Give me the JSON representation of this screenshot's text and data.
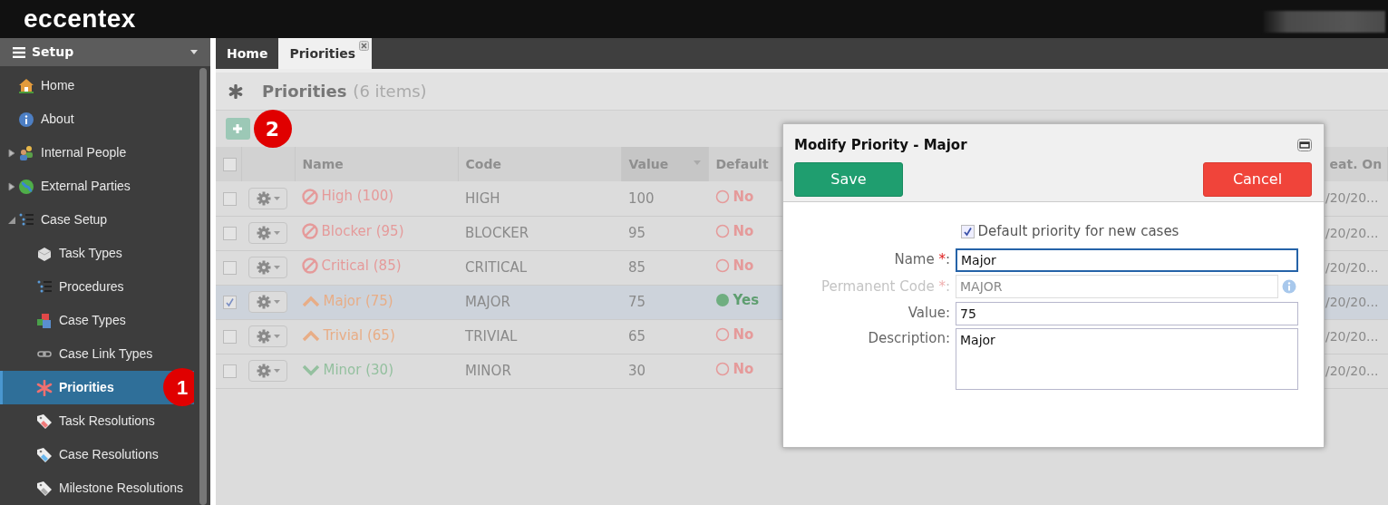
{
  "app": {
    "logo": "eccentex"
  },
  "sidebar": {
    "title": "Setup",
    "items": [
      {
        "label": "Home",
        "selected": false
      },
      {
        "label": "About",
        "selected": false
      },
      {
        "label": "Internal People",
        "selected": false,
        "expanded": false
      },
      {
        "label": "External Parties",
        "selected": false,
        "expanded": false
      },
      {
        "label": "Case Setup",
        "selected": false,
        "expanded": true,
        "children": [
          {
            "label": "Task Types",
            "selected": false
          },
          {
            "label": "Procedures",
            "selected": false
          },
          {
            "label": "Case Types",
            "selected": false
          },
          {
            "label": "Case Link Types",
            "selected": false
          },
          {
            "label": "Priorities",
            "selected": true,
            "callout": "1"
          },
          {
            "label": "Task Resolutions",
            "selected": false
          },
          {
            "label": "Case Resolutions",
            "selected": false
          },
          {
            "label": "Milestone Resolutions",
            "selected": false
          }
        ]
      }
    ]
  },
  "tabs": [
    {
      "label": "Home",
      "selected": false,
      "closable": false
    },
    {
      "label": "Priorities",
      "selected": true,
      "closable": true
    }
  ],
  "page": {
    "title": "Priorities",
    "count": "(6 items)",
    "add_callout": "2"
  },
  "table": {
    "all_checked": false,
    "columns": [
      {
        "label": "Name",
        "sorted": false
      },
      {
        "label": "Code",
        "sorted": false
      },
      {
        "label": "Value",
        "sorted": true
      },
      {
        "label": "Default",
        "sorted": false
      },
      {
        "label": "eat. On",
        "sorted": false
      }
    ],
    "rows": [
      {
        "checked": false,
        "kind": "blocked",
        "color": "#e59a9a",
        "name": "High (100)",
        "code": "HIGH",
        "value": "100",
        "default": false,
        "default_text": "No",
        "column_6": "/20/20..."
      },
      {
        "checked": false,
        "kind": "blocked",
        "color": "#e59a9a",
        "name": "Blocker (95)",
        "code": "BLOCKER",
        "value": "95",
        "default": false,
        "default_text": "No",
        "column_6": "/20/20..."
      },
      {
        "checked": false,
        "kind": "blocked",
        "color": "#e59a9a",
        "name": "Critical (85)",
        "code": "CRITICAL",
        "value": "85",
        "default": false,
        "default_text": "No",
        "column_6": "/20/20..."
      },
      {
        "checked": true,
        "kind": "up",
        "color": "#e8ad86",
        "name": "Major (75)",
        "code": "MAJOR",
        "value": "75",
        "default": true,
        "default_text": "Yes",
        "column_6": "/20/20..."
      },
      {
        "checked": false,
        "kind": "up",
        "color": "#e8ad86",
        "name": "Trivial (65)",
        "code": "TRIVIAL",
        "value": "65",
        "default": false,
        "default_text": "No",
        "column_6": "/20/20..."
      },
      {
        "checked": false,
        "kind": "down",
        "color": "#94c09f",
        "name": "Minor (30)",
        "code": "MINOR",
        "value": "30",
        "default": false,
        "default_text": "No",
        "column_6": "/20/20..."
      }
    ]
  },
  "dialog": {
    "title": "Modify Priority - Major",
    "save": "Save",
    "cancel": "Cancel",
    "checkbox": {
      "label": "Default priority for new cases",
      "checked": true
    },
    "fields": [
      {
        "kind": "input",
        "label": "Name",
        "required_mark": "*",
        "separator": ":",
        "disabled": false,
        "focused": true,
        "value": "Major",
        "info": false
      },
      {
        "kind": "input",
        "label": "Permanent Code",
        "required_mark": "*",
        "separator": ":",
        "disabled": true,
        "focused": false,
        "value": "MAJOR",
        "info": true
      },
      {
        "kind": "input",
        "label": "Value",
        "separator": ":",
        "disabled": false,
        "focused": false,
        "value": "75",
        "info": false
      },
      {
        "kind": "textarea",
        "label": "Description",
        "separator": ":",
        "disabled": false,
        "focused": false,
        "value": "Major",
        "info": false
      }
    ]
  }
}
